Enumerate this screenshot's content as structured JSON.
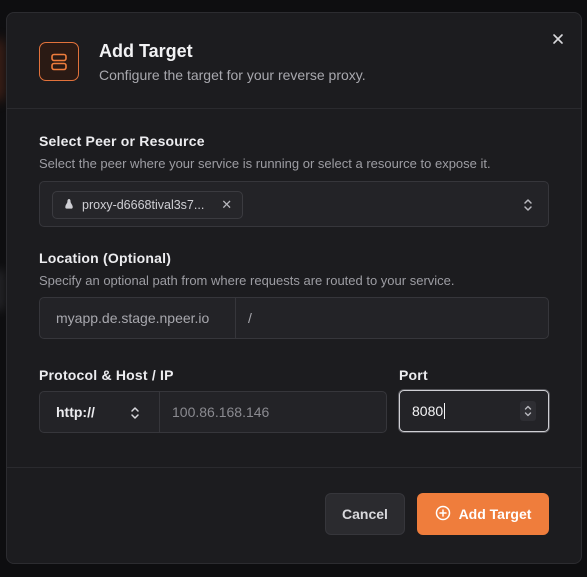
{
  "dialog": {
    "title": "Add Target",
    "subtitle": "Configure the target for your reverse proxy.",
    "icon": "server-icon",
    "accent_color": "#ef7d3c"
  },
  "peer": {
    "label": "Select Peer or Resource",
    "help": "Select the peer where your service is running or select a resource to expose it.",
    "selected_chip": "proxy-d6668tival3s7...",
    "chip_icon": "linux-icon"
  },
  "location": {
    "label": "Location (Optional)",
    "help": "Specify an optional path from where requests are routed to your service.",
    "domain_prefix": "myapp.de.stage.npeer.io",
    "path_placeholder": "/"
  },
  "protocol_host": {
    "label": "Protocol & Host / IP",
    "protocol": "http://",
    "host_placeholder": "100.86.168.146"
  },
  "port": {
    "label": "Port",
    "value": "8080"
  },
  "actions": {
    "cancel": "Cancel",
    "add": "Add Target"
  }
}
